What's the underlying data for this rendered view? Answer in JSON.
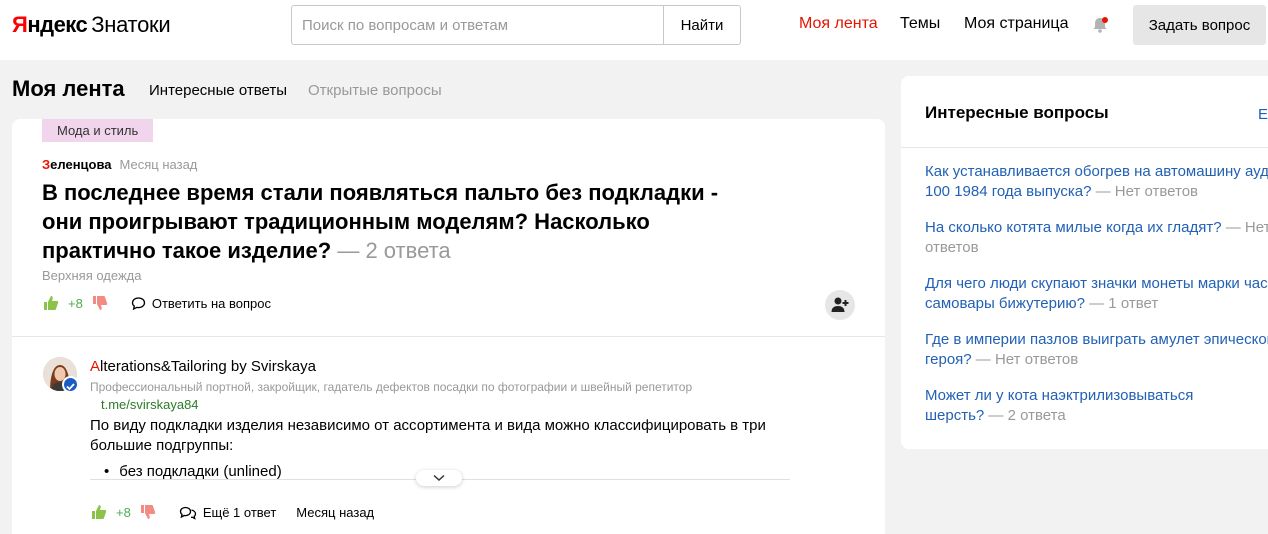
{
  "header": {
    "logo_brand": "Яндекс",
    "logo_product": "Знатоки",
    "search_placeholder": "Поиск по вопросам и ответам",
    "search_button": "Найти",
    "nav": [
      "Моя лента",
      "Темы",
      "Моя страница"
    ],
    "ask_button": "Задать вопрос"
  },
  "feed": {
    "title": "Моя лента",
    "tabs": [
      "Интересные ответы",
      "Открытые вопросы"
    ]
  },
  "question": {
    "tag": "Мода и стиль",
    "author_first": "З",
    "author_rest": "еленцова",
    "time": "Месяц назад",
    "title": "В последнее время стали появляться пальто без подкладки - они проигрывают традиционным моделям? Насколько практично такое изделие?",
    "answers_count": " — 2 ответа",
    "category": "Верхняя одежда",
    "score": "+8",
    "reply_label": "Ответить на вопрос"
  },
  "answer": {
    "author_first": "A",
    "author_rest": "lterations&Tailoring by Svirskaya",
    "description": "Профессиональный портной, закройщик, гадатель дефектов посадки по фотографии и швейный репетитор",
    "link": "t.me/svirskaya84",
    "text": "По виду подкладки изделия независимо от ассортимента и вида можно классифицировать в три большие подгруппы:",
    "bullet": "без подкладки (unlined)",
    "score": "+8",
    "more_label": "Ещё 1 ответ",
    "time": "Месяц назад"
  },
  "sidebar": {
    "title": "Интересные вопросы",
    "cut_label": "Е",
    "items": [
      {
        "line1": "Как устанавливается обогрев на автомашину ауди",
        "line2": "100 1984 года выпуска?",
        "meta": " — Нет ответов"
      },
      {
        "line1": "На сколько котята милые когда их гладят?",
        "meta1": " — Нет",
        "line2": "",
        "meta": "ответов"
      },
      {
        "line1": "Для чего люди скупают значки монеты марки часы",
        "line2": "самовары бижутерию?",
        "meta": " — 1 ответ"
      },
      {
        "line1": "Где в империи пазлов выиграть амулет эпического",
        "line2": "героя?",
        "meta": " — Нет ответов"
      },
      {
        "line1": "Может ли у кота наэктрилизовываться",
        "line2": "шерсть?",
        "meta": " — 2 ответа"
      }
    ]
  },
  "colors": {
    "accent_red": "#e61400",
    "link_blue": "#2261b5",
    "score_green": "#4caf50",
    "tag_bg": "#f0d5ec"
  }
}
